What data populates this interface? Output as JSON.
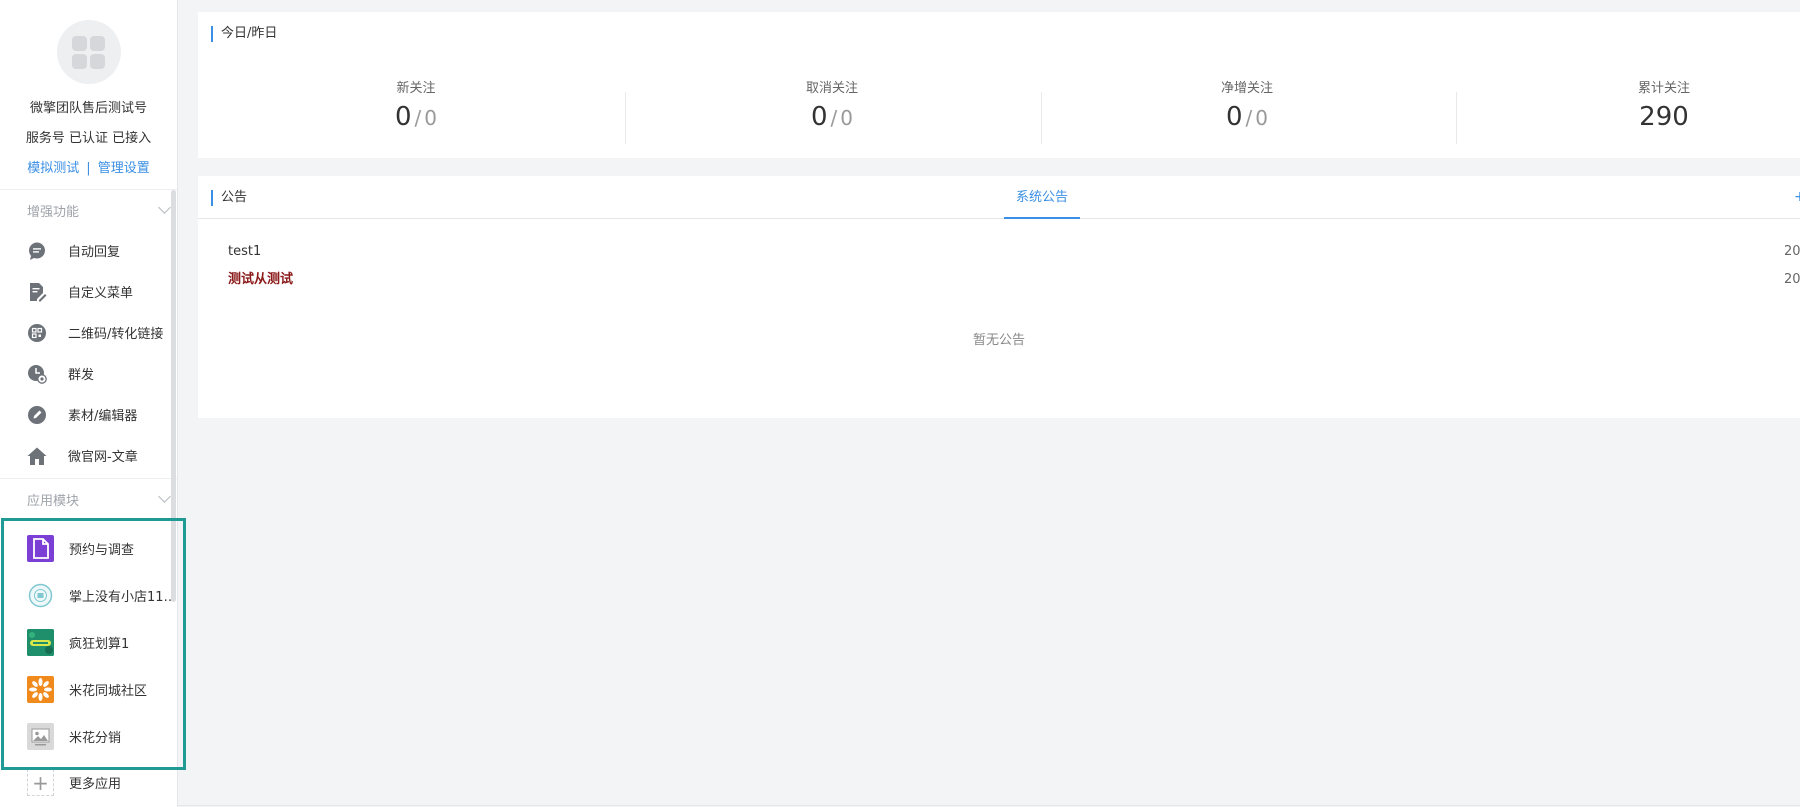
{
  "account": {
    "name": "微擎团队售后测试号",
    "status": "服务号 已认证 已接入",
    "link_simulate": "模拟测试",
    "link_divider": "|",
    "link_manage": "管理设置"
  },
  "sections": {
    "enhance": "增强功能",
    "apps": "应用模块"
  },
  "nav": [
    {
      "label": "自动回复",
      "icon": "chat-bubble-icon"
    },
    {
      "label": "自定义菜单",
      "icon": "edit-document-icon"
    },
    {
      "label": "二维码/转化链接",
      "icon": "qrcode-icon"
    },
    {
      "label": "群发",
      "icon": "clock-send-icon"
    },
    {
      "label": "素材/编辑器",
      "icon": "pencil-icon"
    },
    {
      "label": "微官网-文章",
      "icon": "home-icon"
    }
  ],
  "apps": [
    {
      "label": "预约与调查",
      "icon": "document-app-icon",
      "color": "#7b3fd6"
    },
    {
      "label": "掌上没有小店111...",
      "icon": "shop-app-icon",
      "color": "#7fc8d0"
    },
    {
      "label": "疯狂划算1",
      "icon": "bargain-app-icon",
      "color": "#1e8f6a"
    },
    {
      "label": "米花同城社区",
      "icon": "community-app-icon",
      "color": "#f08a1c"
    },
    {
      "label": "米花分销",
      "icon": "image-placeholder-icon",
      "color": "#d9d9d9"
    }
  ],
  "more_apps": "更多应用",
  "stats": {
    "title": "今日/昨日",
    "items": [
      {
        "label": "新关注",
        "today": "0",
        "sep": "/",
        "yesterday": "0"
      },
      {
        "label": "取消关注",
        "today": "0",
        "sep": "/",
        "yesterday": "0"
      },
      {
        "label": "净增关注",
        "today": "0",
        "sep": "/",
        "yesterday": "0"
      },
      {
        "label": "累计关注",
        "today": "290"
      }
    ]
  },
  "notice": {
    "title": "公告",
    "tab_system": "系统公告",
    "rows": [
      {
        "title": "test1",
        "date": "20"
      },
      {
        "title": "测试从测试",
        "date": "20"
      }
    ],
    "empty": "暂无公告",
    "add": "+"
  },
  "colors": {
    "accent": "#3b8fe4",
    "highlight_box": "#1f9a95",
    "notice_red": "#8b1a1a"
  }
}
